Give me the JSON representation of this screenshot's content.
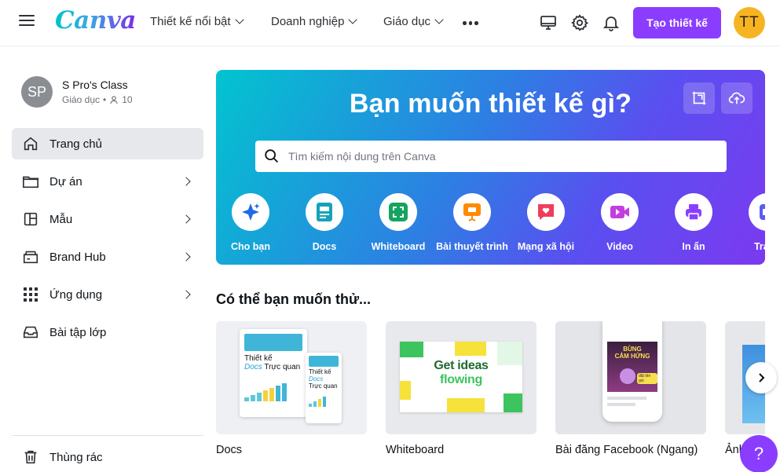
{
  "header": {
    "logo": "Canva",
    "nav": [
      {
        "label": "Thiết kế nổi bật"
      },
      {
        "label": "Doanh nghiệp"
      },
      {
        "label": "Giáo dục"
      }
    ],
    "create_label": "Tạo thiết kế",
    "avatar_initials": "TT",
    "brand_color": "#8b3dff",
    "avatar_color": "#f7b422"
  },
  "sidebar": {
    "team": {
      "initials": "SP",
      "name": "S Pro's Class",
      "type": "Giáo dục",
      "members": "10"
    },
    "items": [
      {
        "label": "Trang chủ",
        "icon": "home-icon"
      },
      {
        "label": "Dự án",
        "icon": "folder-icon"
      },
      {
        "label": "Mẫu",
        "icon": "template-icon"
      },
      {
        "label": "Brand Hub",
        "icon": "brand-hub-icon"
      },
      {
        "label": "Ứng dụng",
        "icon": "apps-grid-icon"
      },
      {
        "label": "Bài tập lớp",
        "icon": "inbox-icon"
      },
      {
        "label": "Thùng rác",
        "icon": "trash-icon"
      }
    ]
  },
  "hero": {
    "title": "Bạn muốn thiết kế gì?",
    "search_placeholder": "Tìm kiếm nội dung trên Canva",
    "categories": [
      {
        "label": "Cho bạn",
        "icon": "sparkle-icon",
        "color": "#1d6ae5"
      },
      {
        "label": "Docs",
        "icon": "docs-icon",
        "color": "#14a3b8"
      },
      {
        "label": "Whiteboard",
        "icon": "whiteboard-icon",
        "color": "#15a361"
      },
      {
        "label": "Bài thuyết trình",
        "icon": "presentation-icon",
        "color": "#ff8a00"
      },
      {
        "label": "Mạng xã hội",
        "icon": "heart-chat-icon",
        "color": "#ef3e5c"
      },
      {
        "label": "Video",
        "icon": "video-icon",
        "color": "#c33ee0"
      },
      {
        "label": "In ấn",
        "icon": "printer-icon",
        "color": "#8b3dff"
      },
      {
        "label": "Trang",
        "icon": "page-icon",
        "color": "#5b5ef0"
      }
    ]
  },
  "suggestions": {
    "title": "Có thể bạn muốn thử...",
    "cards": [
      {
        "name": "Docs",
        "thumb": {
          "line1": "Thiết kế",
          "line2": "Docs",
          "line3": "Trực quan",
          "small1": "Thiết kế",
          "small2": "Docs",
          "small3": "Trực quan"
        }
      },
      {
        "name": "Whiteboard",
        "thumb": {
          "line1": "Get ideas",
          "line2": "flowing"
        }
      },
      {
        "name": "Bài đăng Facebook (Ngang)",
        "thumb": {
          "line1": "BÙNG",
          "line2": "CẢM HỨNG",
          "badge": "đặt tên gọi"
        }
      },
      {
        "name": "Ảnh"
      }
    ]
  },
  "help_label": "?"
}
